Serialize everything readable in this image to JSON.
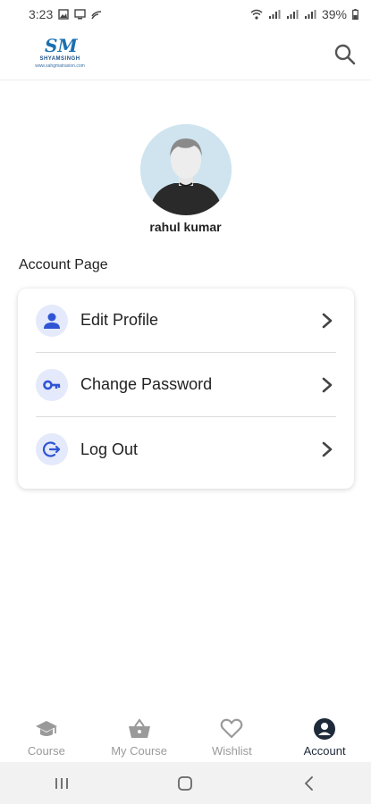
{
  "status_bar": {
    "time": "3:23",
    "battery": "39%"
  },
  "header": {
    "logo_mark": "SM",
    "logo_name": "SHYAMSINGH",
    "logo_url": "www.sahgmatraxion.com",
    "search_icon": "search-icon"
  },
  "profile": {
    "name": "rahul kumar",
    "avatar_icon": "user-avatar"
  },
  "section": {
    "title": "Account Page"
  },
  "menu": {
    "items": [
      {
        "label": "Edit Profile",
        "icon": "person-icon"
      },
      {
        "label": "Change Password",
        "icon": "key-icon"
      },
      {
        "label": "Log Out",
        "icon": "logout-icon"
      }
    ]
  },
  "bottom_nav": {
    "items": [
      {
        "label": "Course",
        "icon": "graduation-cap-icon"
      },
      {
        "label": "My Course",
        "icon": "basket-icon"
      },
      {
        "label": "Wishlist",
        "icon": "heart-icon"
      },
      {
        "label": "Account",
        "icon": "account-icon",
        "active": true
      }
    ]
  },
  "colors": {
    "accent": "#2f55d4",
    "icon_bg": "#e4e9fb",
    "active_nav": "#1e2a3a",
    "inactive_nav": "#9a9a9a"
  }
}
